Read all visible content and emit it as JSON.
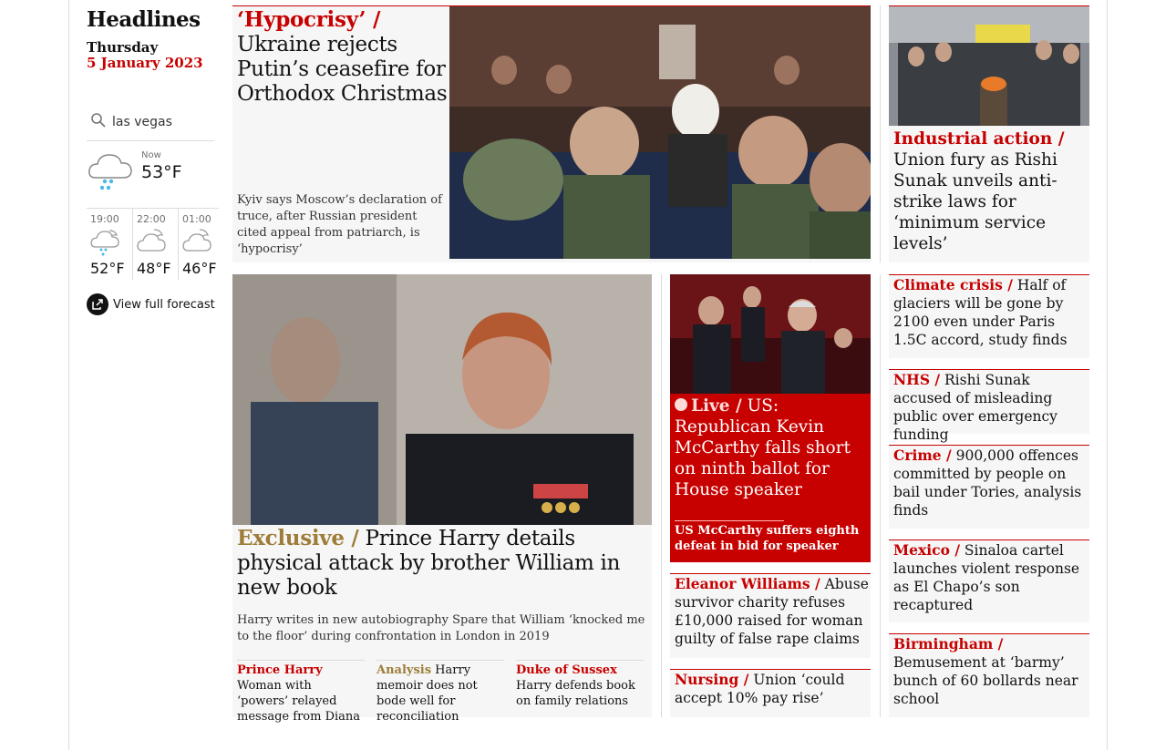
{
  "section": {
    "title": "Headlines",
    "day": "Thursday",
    "date": "5 January 2023"
  },
  "weather": {
    "search_value": "las vegas",
    "now_label": "Now",
    "now_temp": "53°F",
    "now_icon": "rain-cloud-icon",
    "forecast": [
      {
        "time": "19:00",
        "temp": "52°F",
        "icon": "night-rain-icon"
      },
      {
        "time": "22:00",
        "temp": "48°F",
        "icon": "night-cloud-icon"
      },
      {
        "time": "01:00",
        "temp": "46°F",
        "icon": "night-cloud-icon"
      }
    ],
    "full_forecast_label": "View full forecast"
  },
  "main_story": {
    "kicker": "‘Hypocrisy’ /",
    "headline": "Ukraine rejects Putin’s ceasefire for Orthodox Christmas",
    "standfirst": "Kyiv says Moscow’s declaration of truce, after Russian president cited appeal from patriarch, is ‘hypocrisy’"
  },
  "right_top": {
    "kicker": "Industrial action /",
    "headline": "Union fury as Rishi Sunak unveils anti-strike laws for ‘minimum service levels’"
  },
  "harry": {
    "kicker": "Exclusive /",
    "headline": "Prince Harry details physical attack by brother William in new book",
    "standfirst": "Harry writes in new autobiography Spare that William ‘knocked me to the floor’ during confrontation in London in 2019",
    "sublinks": [
      {
        "kicker": "Prince Harry",
        "headline": "Woman with ‘powers’ relayed message from Diana"
      },
      {
        "kicker": "Analysis",
        "headline": "Harry memoir does not bode well for reconciliation"
      },
      {
        "kicker": "Duke of Sussex",
        "headline": "Harry defends book on family relations"
      }
    ]
  },
  "live": {
    "kicker": "Live /",
    "headline": "US: Republican Kevin McCarthy falls short on ninth ballot for House speaker",
    "sublink": "US McCarthy suffers eighth defeat in bid for speaker"
  },
  "middle_small": [
    {
      "kicker": "Eleanor Williams /",
      "headline": "Abuse survivor charity refuses £10,000 raised for woman guilty of false rape claims"
    },
    {
      "kicker": "Nursing /",
      "headline": "Union ‘could accept 10% pay rise’"
    }
  ],
  "right_small": [
    {
      "kicker": "Climate crisis  /",
      "headline": "Half of glaciers will be gone by 2100 even under Paris 1.5C accord, study finds"
    },
    {
      "kicker": "NHS /",
      "headline": "Rishi Sunak accused of misleading public over emergency funding"
    },
    {
      "kicker": "Crime /",
      "headline": "900,000 offences committed by people on bail under Tories, analysis finds"
    },
    {
      "kicker": "Mexico /",
      "headline": "Sinaloa cartel launches violent response as El Chapo’s son recaptured"
    },
    {
      "kicker": "Birmingham /",
      "headline": "Bemusement at ‘barmy’ bunch of 60 bollards near school"
    }
  ],
  "colors": {
    "news_red": "#c70000",
    "exclusive_gold": "#9e7d3a",
    "card_bg": "#f6f6f6"
  }
}
